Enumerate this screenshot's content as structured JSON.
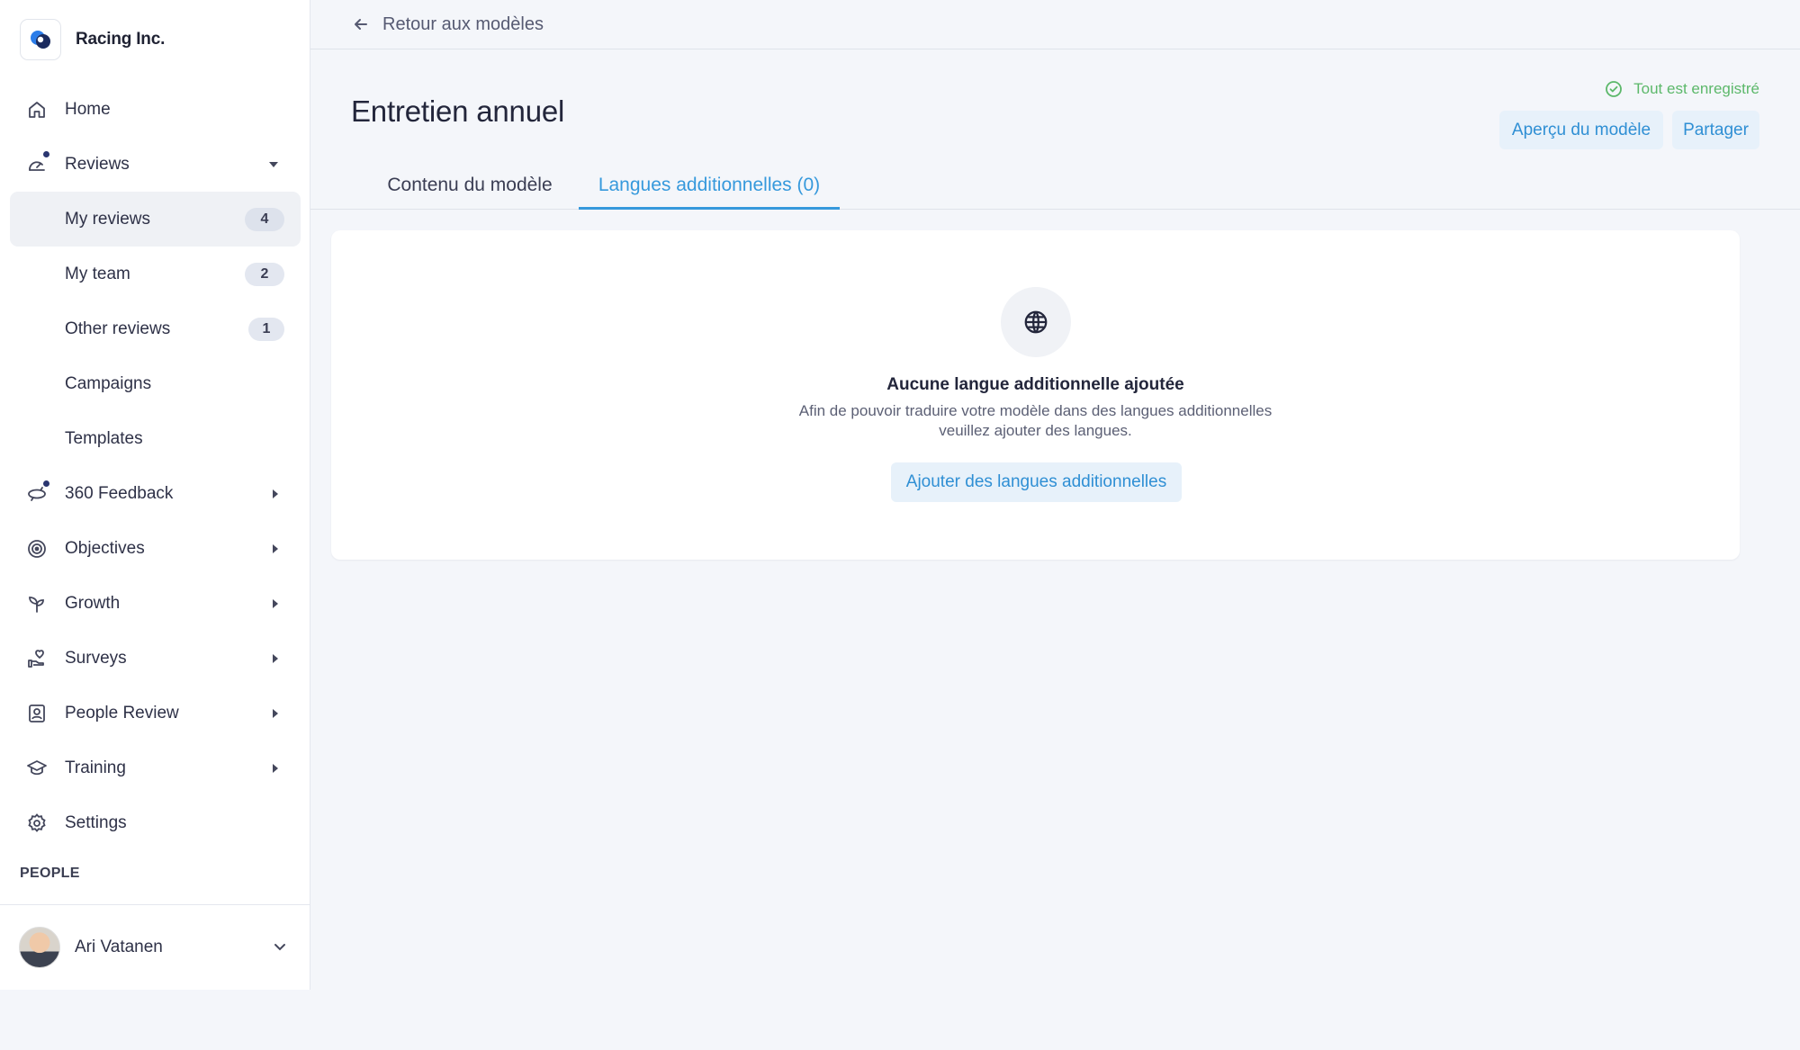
{
  "brand": {
    "name": "Racing Inc."
  },
  "nav": {
    "home": "Home",
    "reviews": "Reviews",
    "my_reviews": {
      "label": "My reviews",
      "count": "4"
    },
    "my_team": {
      "label": "My team",
      "count": "2"
    },
    "other_reviews": {
      "label": "Other reviews",
      "count": "1"
    },
    "campaigns": "Campaigns",
    "templates": "Templates",
    "feedback_360": "360 Feedback",
    "objectives": "Objectives",
    "growth": "Growth",
    "surveys": "Surveys",
    "people_review": "People Review",
    "training": "Training",
    "settings": "Settings",
    "section_people": "PEOPLE"
  },
  "user": {
    "name": "Ari Vatanen"
  },
  "topbar": {
    "back_label": "Retour aux modèles"
  },
  "page": {
    "title": "Entretien annuel",
    "saved_status": "Tout est enregistré",
    "preview_button": "Aperçu du modèle",
    "share_button": "Partager"
  },
  "tabs": [
    {
      "label": "Contenu du modèle",
      "active": false
    },
    {
      "label": "Langues additionnelles (0)",
      "active": true
    }
  ],
  "empty_state": {
    "icon": "globe-icon",
    "title": "Aucune langue additionnelle ajoutée",
    "description_line1": "Afin de pouvoir traduire votre modèle dans des langues additionnelles",
    "description_line2": "veuillez ajouter des langues.",
    "add_button": "Ajouter des langues additionnelles"
  },
  "colors": {
    "accent": "#3699dc",
    "accent_bg": "#e7f1fa",
    "success": "#5cb86a",
    "active_nav_bg": "#eff1f5"
  }
}
